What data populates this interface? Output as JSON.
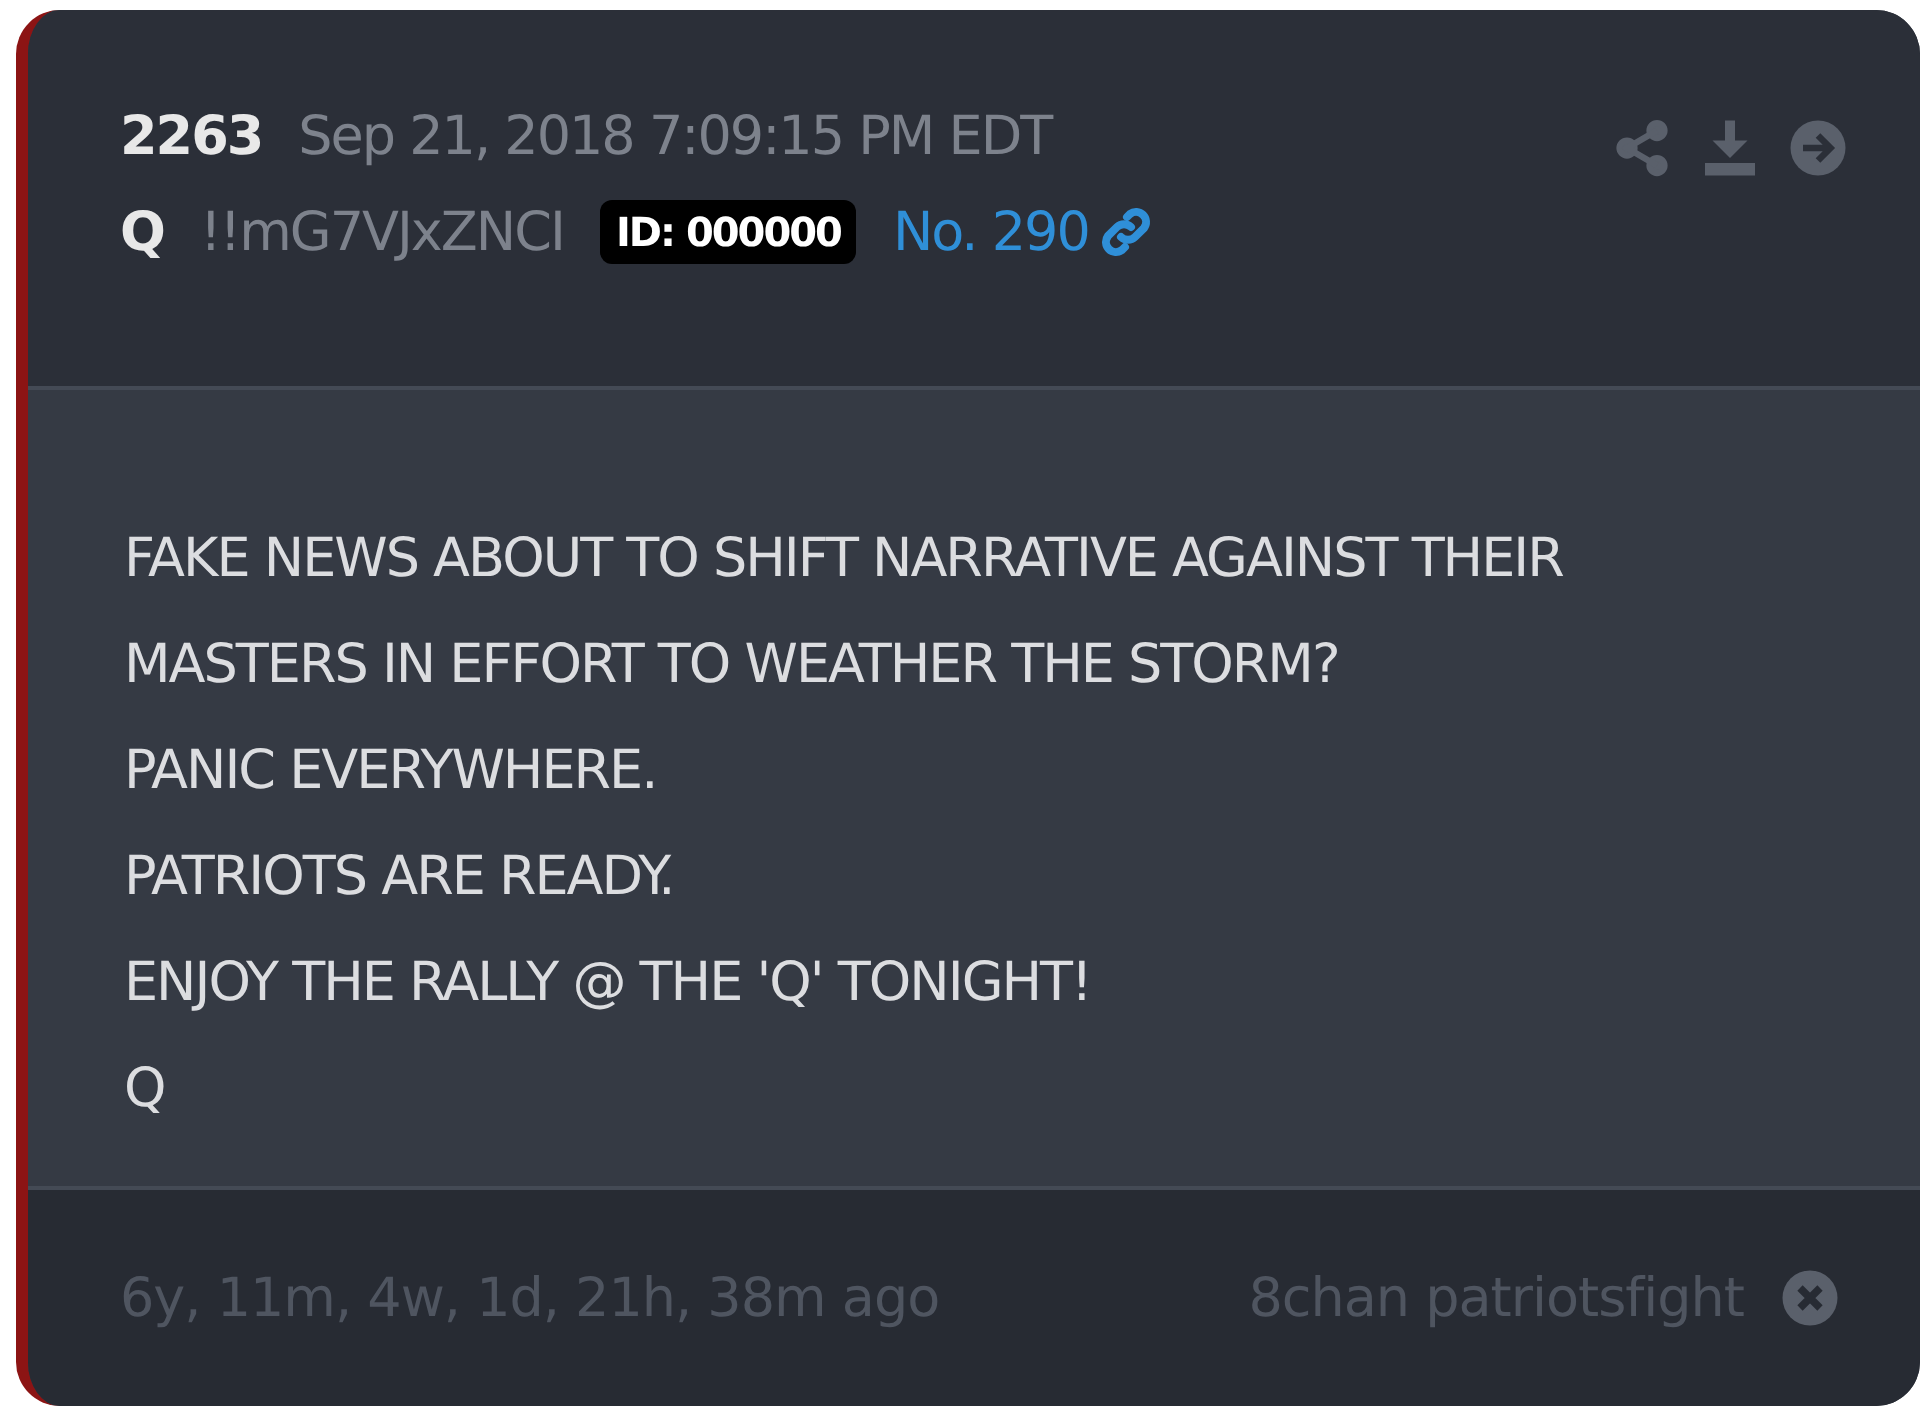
{
  "post": {
    "number": "2263",
    "timestamp": "Sep 21, 2018 7:09:15 PM EDT",
    "author": "Q",
    "tripcode": "!!mG7VJxZNCI",
    "id_badge": "ID: 000000",
    "post_no": "No. 290"
  },
  "body_lines": [
    "FAKE NEWS ABOUT TO SHIFT NARRATIVE AGAINST THEIR",
    "MASTERS IN EFFORT TO WEATHER THE STORM?",
    "PANIC EVERYWHERE.",
    "PATRIOTS ARE READY.",
    "ENJOY THE RALLY @ THE 'Q' TONIGHT!",
    "Q"
  ],
  "footer": {
    "age": "6y, 11m, 4w, 1d, 21h, 38m ago",
    "source": "8chan patriotsfight"
  }
}
